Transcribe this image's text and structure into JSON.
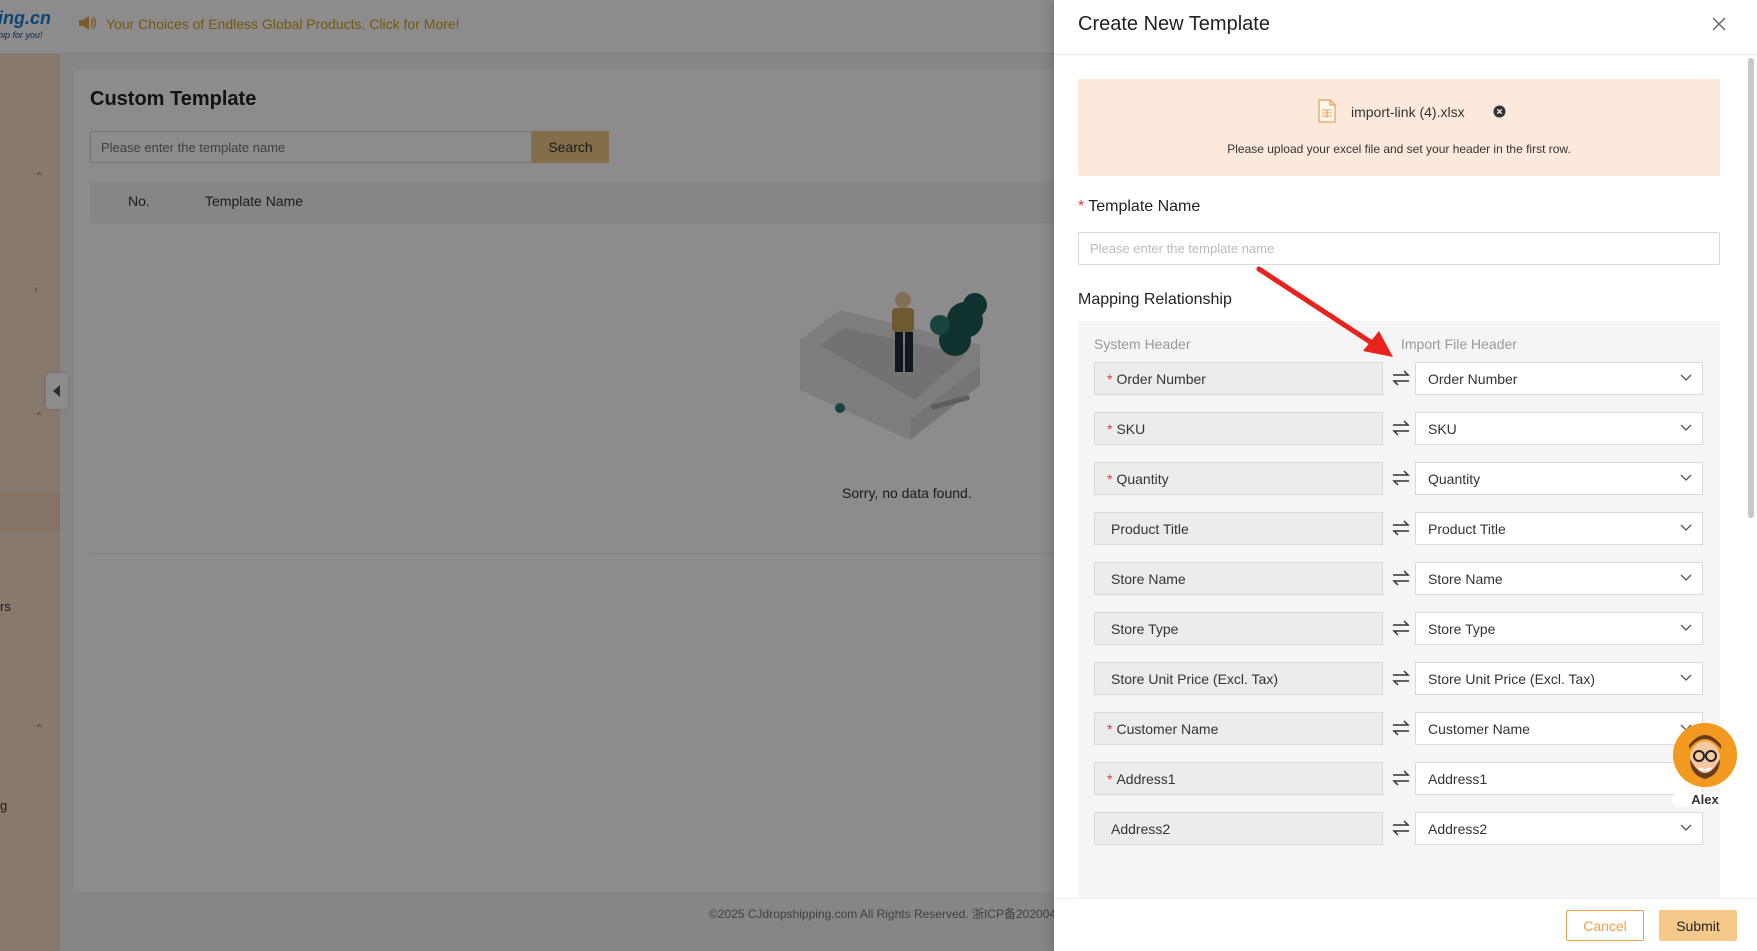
{
  "background": {
    "logo_text": "ing.cn",
    "logo_sub": "hip for you!",
    "announcement": "Your Choices of Endless Global Products. Click for More!",
    "sidebar_fragments": [
      "rs",
      "g"
    ],
    "page_title": "Custom Template",
    "search": {
      "placeholder": "Please enter the template name",
      "button": "Search"
    },
    "table": {
      "columns": [
        "No.",
        "Template Name"
      ],
      "empty_text": "Sorry, no data found."
    },
    "copyright": "©2025 CJdropshipping.com All Rights Reserved. 浙ICP备202004"
  },
  "drawer": {
    "title": "Create New Template",
    "upload": {
      "file_name": "import-link (4).xlsx",
      "hint": "Please upload your excel file and set your header in the first row."
    },
    "template_name": {
      "label": "Template Name",
      "required": "*",
      "placeholder": "Please enter the template name",
      "value": ""
    },
    "mapping": {
      "label": "Mapping Relationship",
      "system_header_label": "System Header",
      "import_header_label": "Import File Header",
      "rows": [
        {
          "system": "Order Number",
          "required": "*",
          "import": "Order Number"
        },
        {
          "system": "SKU",
          "required": "*",
          "import": "SKU"
        },
        {
          "system": "Quantity",
          "required": "*",
          "import": "Quantity"
        },
        {
          "system": "Product Title",
          "required": "",
          "import": "Product Title"
        },
        {
          "system": "Store Name",
          "required": "",
          "import": "Store Name"
        },
        {
          "system": "Store Type",
          "required": "",
          "import": "Store Type"
        },
        {
          "system": "Store Unit Price (Excl. Tax)",
          "required": "",
          "import": "Store Unit Price (Excl. Tax)"
        },
        {
          "system": "Customer Name",
          "required": "*",
          "import": "Customer Name"
        },
        {
          "system": "Address1",
          "required": "*",
          "import": "Address1"
        },
        {
          "system": "Address2",
          "required": "",
          "import": "Address2"
        }
      ]
    },
    "footer": {
      "cancel": "Cancel",
      "submit": "Submit"
    }
  },
  "chat": {
    "agent_name": "Alex"
  },
  "colors": {
    "accent": "#f5c98a",
    "cancel_border": "#f0a04b",
    "required": "#e4393c",
    "upload_bg": "#fde9dc",
    "arrow": "#e8221c"
  }
}
